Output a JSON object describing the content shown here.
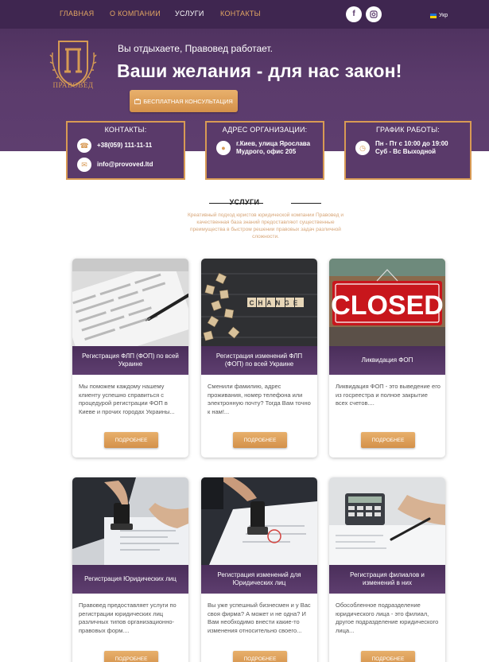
{
  "nav": {
    "items": [
      "ГЛАВНАЯ",
      "О КОМПАНИИ",
      "УСЛУГИ",
      "КОНТАКТЫ"
    ],
    "active_index": 2,
    "lang": "Укр"
  },
  "hero": {
    "logo_text": "ПРАВОВЕД",
    "tagline": "Вы отдыхаете, Правовед работает.",
    "headline": "Ваши желания - для нас закон!",
    "cta_label": "БЕСПЛАТНАЯ КОНСУЛЬТАЦИЯ"
  },
  "info": {
    "contacts": {
      "title": "КОНТАКТЫ:",
      "phone": "+38(059) 111-11-11",
      "email": "info@provoved.ltd"
    },
    "address": {
      "title": "АДРЕС ОРГАНИЗАЦИИ:",
      "line1": "г.Киев, улица Ярослава",
      "line2": "Мудрого, офис 205"
    },
    "schedule": {
      "title": "ГРАФИК РАБОТЫ:",
      "line1": "Пн - Пт с 10:00 до 19:00",
      "line2": "Суб - Вс Выходной"
    }
  },
  "services": {
    "title": "УСЛУГИ",
    "description": "Креативный подход юристов юридической компании Правовед и качественная база знаний предоставляют существенные преимущества в быстром решении правовых задач различной сложности.",
    "button_label": "ПОДРОБНЕЕ",
    "cards": [
      {
        "title": "Регистрация ФЛП (ФОП) по всей Украине",
        "text": "Мы поможем каждому нашему клиенту успешно справиться с процедурой регистрации ФОП в Киеве и прочих городах Украины..."
      },
      {
        "title": "Регистрация изменений ФЛП (ФОП) по всей Украине",
        "text": "Сменили фамилию, адрес проживания, номер телефона или электронную почту? Тогда Вам точно к нам!..."
      },
      {
        "title": "Ликвидация ФОП",
        "text": "Ликвидация ФОП - это выведение его из госреестра и полное закрытие всех счетов...."
      },
      {
        "title": "Регистрация Юридических лиц",
        "text": "Правовед предоставляет услуги по регистрации юридических лиц различных типов организационно-правовых форм...."
      },
      {
        "title": "Регистрация изменений для Юридических лиц",
        "text": "Вы уже успешный бизнесмен и у Вас своя фирма? А может и не одна? И Вам необходимо внести какие-то изменения относительно своего..."
      },
      {
        "title": "Регистрация филиалов и изменений в них",
        "text": "Обособленное подразделение юридического лица - это филиал, другое подразделение юридического лица..."
      }
    ],
    "image_words": {
      "change": "CHANGE",
      "closed": "CLOSED"
    }
  },
  "colors": {
    "brand_purple": "#5b3b6c",
    "accent_gold": "#d89a54"
  }
}
